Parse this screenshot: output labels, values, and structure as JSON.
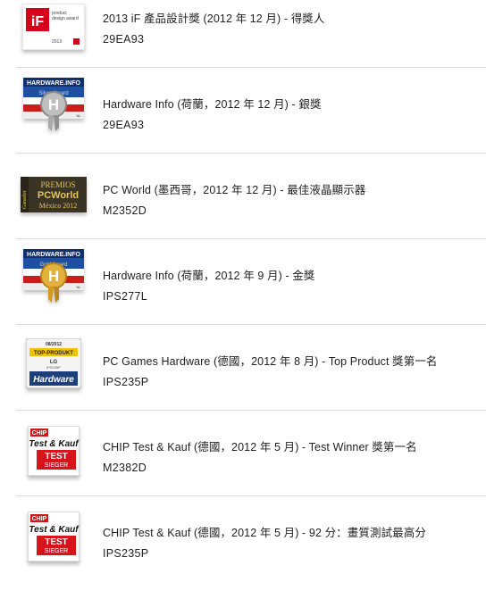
{
  "colors": {
    "divider": "#dcdcdc",
    "if_red": "#d9001b",
    "hw_blue": "#1e4fa3",
    "hw_red": "#c81e1e",
    "chip_red": "#d7141a",
    "pcworld_bg": "#3a3424",
    "pcworld_gold": "#e6c35a"
  },
  "awards": [
    {
      "title": "2013 iF  產品設計獎 (2012 年 12 月)  - 得獎人",
      "model": "29EA93",
      "badge": {
        "type": "if-award",
        "logo": "iF",
        "line1": "product",
        "line2": "design award",
        "year": "2013"
      }
    },
    {
      "title": "Hardware Info (荷蘭，2012 年 12 月) - 銀獎",
      "model": "29EA93",
      "badge": {
        "type": "hardware-info-silver",
        "brand": "HARDWARE.INFO",
        "ribbon": "Silver Award",
        "letter": "H",
        "country": "NL"
      }
    },
    {
      "title": "PC World (墨西哥，2012 年 12 月) - 最佳液晶顯示器",
      "model": "M2352D",
      "badge": {
        "type": "pcworld-premios",
        "line1": "PREMIOS",
        "line2": "PCWorld",
        "line3": "México 2012",
        "side": "Ganador"
      }
    },
    {
      "title": "Hardware Info (荷蘭，2012 年 9 月) - 金獎",
      "model": "IPS277L",
      "badge": {
        "type": "hardware-info-gold",
        "brand": "HARDWARE.INFO",
        "ribbon": "Gold Award",
        "letter": "H",
        "country": "NL"
      }
    },
    {
      "title": "PC Games Hardware (德國，2012 年 8 月) - Top Product 獎第一名",
      "model": "IPS235P",
      "badge": {
        "type": "pcgames-top",
        "date": "08/2012",
        "ribbon": "TOP-PRODUKT",
        "brand": "LG",
        "model": "IPS235P",
        "logo": "Hardware"
      }
    },
    {
      "title": "CHIP Test & Kauf (德國，2012 年 5 月) - Test Winner 獎第一名",
      "model": "M2382D",
      "badge": {
        "type": "chip-test",
        "chip": "CHIP",
        "line1": "Test & Kauf",
        "line2": "TEST",
        "line3": "SIEGER"
      }
    },
    {
      "title": "CHIP Test & Kauf (德國，2012 年 5 月) - 92 分：畫質測試最高分",
      "model": "IPS235P",
      "badge": {
        "type": "chip-test",
        "chip": "CHIP",
        "line1": "Test & Kauf",
        "line2": "TEST",
        "line3": "SIEGER"
      }
    }
  ]
}
